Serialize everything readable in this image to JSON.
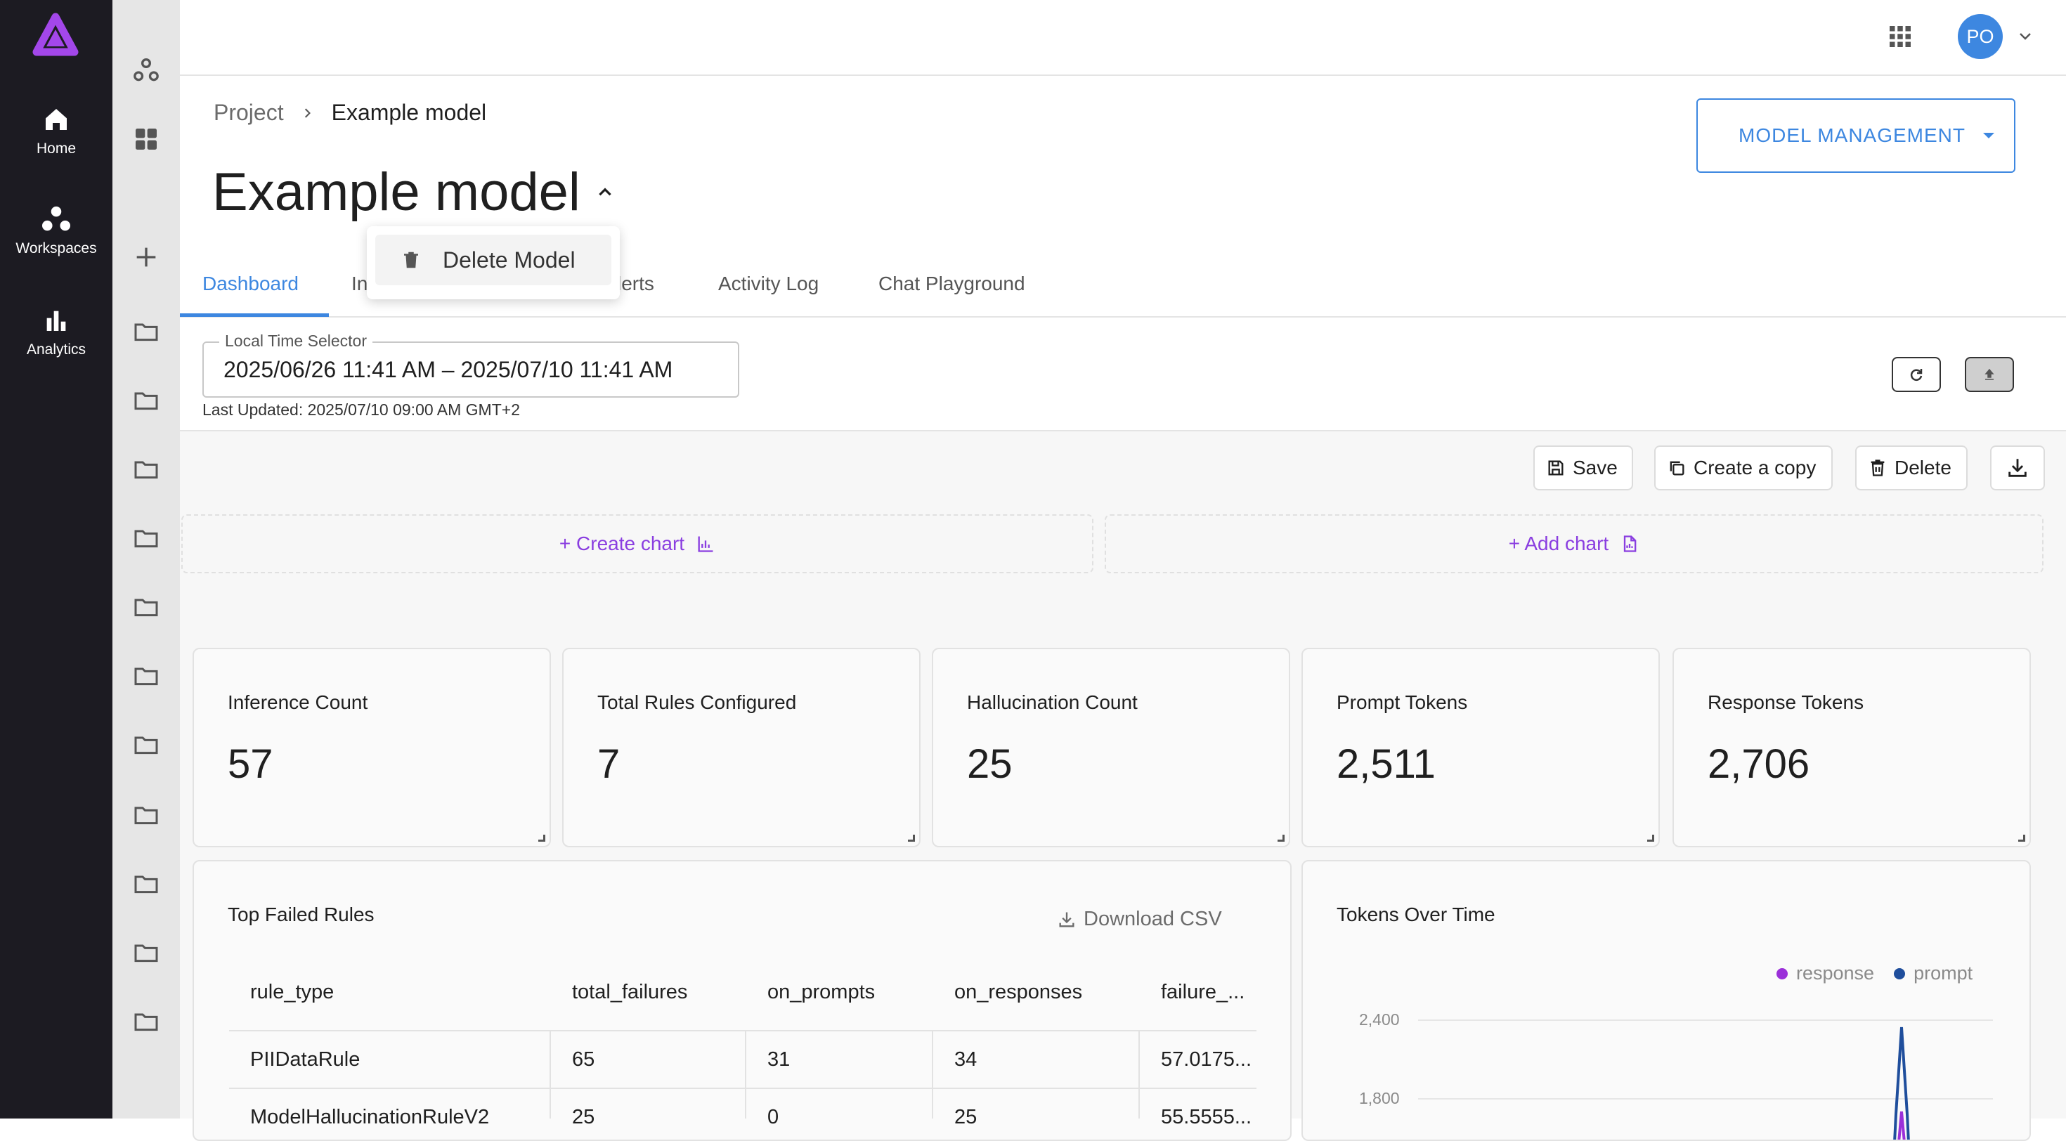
{
  "nav": {
    "items": [
      {
        "label": "Home"
      },
      {
        "label": "Workspaces"
      },
      {
        "label": "Analytics"
      }
    ]
  },
  "header": {
    "avatar": "PO"
  },
  "breadcrumb": {
    "parent": "Project",
    "current": "Example model"
  },
  "page_title": "Example model",
  "menu": {
    "delete_model": "Delete Model"
  },
  "model_management": "MODEL MANAGEMENT",
  "tabs": [
    "Dashboard",
    "In",
    "lerts",
    "Activity Log",
    "Chat Playground"
  ],
  "time_selector": {
    "label": "Local Time Selector",
    "value": "2025/06/26 11:41 AM – 2025/07/10 11:41 AM",
    "last_updated": "Last Updated: 2025/07/10 09:00 AM GMT+2"
  },
  "toolbar": {
    "save": "Save",
    "copy": "Create a copy",
    "delete": "Delete"
  },
  "create_chart": "+ Create chart",
  "add_chart": "+ Add chart",
  "metrics": [
    {
      "title": "Inference Count",
      "value": "57"
    },
    {
      "title": "Total Rules Configured",
      "value": "7"
    },
    {
      "title": "Hallucination Count",
      "value": "25"
    },
    {
      "title": "Prompt Tokens",
      "value": "2,511"
    },
    {
      "title": "Response Tokens",
      "value": "2,706"
    }
  ],
  "failed_rules": {
    "title": "Top Failed Rules",
    "download": "Download CSV",
    "columns": [
      "rule_type",
      "total_failures",
      "on_prompts",
      "on_responses",
      "failure_..."
    ],
    "rows": [
      [
        "PIIDataRule",
        "65",
        "31",
        "34",
        "57.0175..."
      ],
      [
        "ModelHallucinationRuleV2",
        "25",
        "0",
        "25",
        "55.5555..."
      ]
    ]
  },
  "tokens_chart": {
    "title": "Tokens Over Time",
    "legend": [
      {
        "name": "response",
        "color": "#9b30d9"
      },
      {
        "name": "prompt",
        "color": "#1f4e9c"
      }
    ],
    "y_ticks": [
      "2,400",
      "1,800"
    ]
  },
  "colors": {
    "accent": "#3d87e0",
    "brand": "#9b30d9",
    "nav_bg": "#1c1b22"
  }
}
